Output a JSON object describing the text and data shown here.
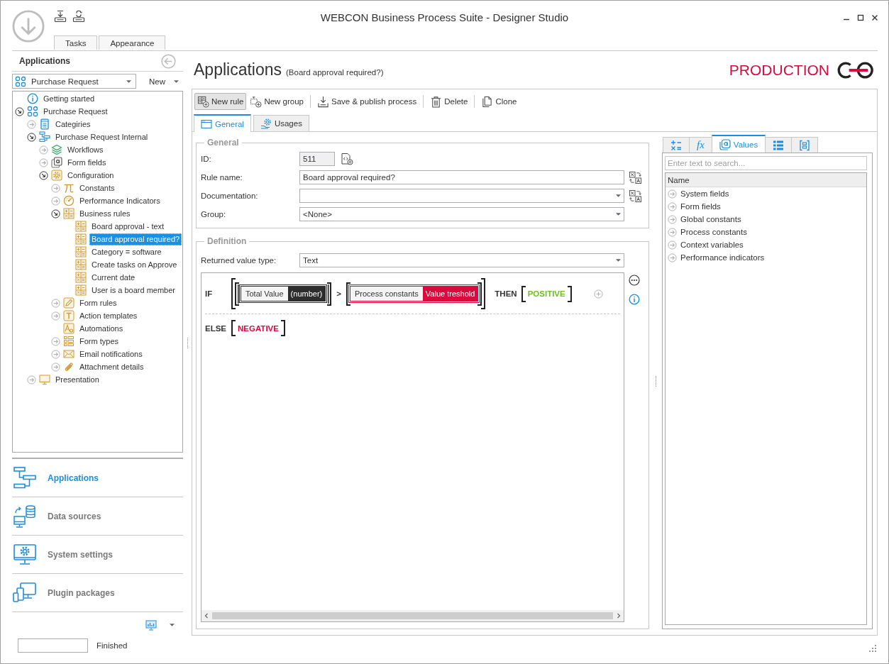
{
  "window": {
    "title": "WEBCON Business Process Suite - Designer Studio"
  },
  "ribbon": {
    "tabs": [
      {
        "label": "Tasks",
        "selected": false
      },
      {
        "label": "Appearance",
        "selected": false
      }
    ]
  },
  "sidebar": {
    "title": "Applications",
    "app_select": {
      "value": "Purchase Request"
    },
    "new_button": {
      "label": "New"
    },
    "tree": [
      {
        "label": "Getting started",
        "kind": "info",
        "selected": false
      },
      {
        "label": "Purchase Request",
        "kind": "app",
        "expanded": true,
        "selected": false,
        "children": [
          {
            "label": "Categiries",
            "kind": "category",
            "expanded": false,
            "selected": false
          },
          {
            "label": "Purchase Request Internal",
            "kind": "process",
            "expanded": true,
            "selected": false,
            "children": [
              {
                "label": "Workflows",
                "kind": "workflow",
                "expanded": false,
                "selected": false
              },
              {
                "label": "Form fields",
                "kind": "formfield",
                "expanded": false,
                "selected": false
              },
              {
                "label": "Configuration",
                "kind": "config",
                "expanded": true,
                "selected": false,
                "children": [
                  {
                    "label": "Constants",
                    "kind": "constant",
                    "expanded": false,
                    "selected": false
                  },
                  {
                    "label": "Performance Indicators",
                    "kind": "kpi",
                    "expanded": false,
                    "selected": false
                  },
                  {
                    "label": "Business rules",
                    "kind": "rule",
                    "expanded": true,
                    "selected": false,
                    "children": [
                      {
                        "label": "Board approval - text",
                        "kind": "rule",
                        "selected": false
                      },
                      {
                        "label": "Board approval required?",
                        "kind": "rule",
                        "selected": true
                      },
                      {
                        "label": "Category = software",
                        "kind": "rule",
                        "selected": false
                      },
                      {
                        "label": "Create tasks on Approve",
                        "kind": "rule",
                        "selected": false
                      },
                      {
                        "label": "Current date",
                        "kind": "rule",
                        "selected": false
                      },
                      {
                        "label": "User is a board member",
                        "kind": "rule",
                        "selected": false
                      }
                    ]
                  },
                  {
                    "label": "Form rules",
                    "kind": "formrule",
                    "expanded": false,
                    "selected": false
                  },
                  {
                    "label": "Action templates",
                    "kind": "template",
                    "expanded": false,
                    "selected": false
                  },
                  {
                    "label": "Automations",
                    "kind": "automation",
                    "selected": false
                  },
                  {
                    "label": "Form types",
                    "kind": "formtype",
                    "expanded": false,
                    "selected": false
                  },
                  {
                    "label": "Email notifications",
                    "kind": "email",
                    "expanded": false,
                    "selected": false
                  },
                  {
                    "label": "Attachment details",
                    "kind": "attachment",
                    "expanded": false,
                    "selected": false
                  }
                ]
              }
            ]
          },
          {
            "label": "Presentation",
            "kind": "presentation",
            "expanded": false,
            "selected": false
          }
        ]
      }
    ],
    "nav": [
      {
        "label": "Applications",
        "kind": "applications",
        "selected": true
      },
      {
        "label": "Data sources",
        "kind": "data-sources",
        "selected": false
      },
      {
        "label": "System settings",
        "kind": "system-settings",
        "selected": false
      },
      {
        "label": "Plugin packages",
        "kind": "plugins",
        "selected": false
      }
    ]
  },
  "status_bar": {
    "text": "Finished"
  },
  "header": {
    "title": "Applications",
    "subtitle": "(Board approval required?)",
    "environment": "PRODUCTION"
  },
  "toolbar": [
    [
      {
        "label": "New rule",
        "kind": "new-rule",
        "pressed": true
      },
      {
        "label": "New group",
        "kind": "new-group",
        "pressed": false
      }
    ],
    [
      {
        "label": "Save & publish process",
        "kind": "save",
        "pressed": false
      }
    ],
    [
      {
        "label": "Delete",
        "kind": "delete",
        "pressed": false
      }
    ],
    [
      {
        "label": "Clone",
        "kind": "clone",
        "pressed": false
      }
    ]
  ],
  "editor_tabs": [
    {
      "label": "General",
      "kind": "general",
      "selected": true
    },
    {
      "label": "Usages",
      "kind": "usages",
      "selected": false
    }
  ],
  "general": {
    "legend": "General",
    "fields": [
      {
        "label": "ID:",
        "kind": "readonly",
        "value": "511",
        "translatable": false
      },
      {
        "label": "Rule name:",
        "kind": "text",
        "value": "Board approval required?",
        "translatable": true
      },
      {
        "label": "Documentation:",
        "kind": "dropdown",
        "translatable": true
      },
      {
        "label": "Group:",
        "kind": "dropdown",
        "value": "<None>",
        "translatable": false
      }
    ]
  },
  "definition": {
    "legend": "Definition",
    "return_type": {
      "label": "Returned value type:",
      "value": "Text"
    },
    "rule": {
      "if_keyword": "IF",
      "condition": {
        "operator": ">",
        "operands": [
          {
            "label": "Total Value",
            "tag": "(number)",
            "color": "#2d2d2d"
          },
          {
            "label": "Process constants",
            "tag": "Value treshold",
            "color": "#dc0a3c"
          }
        ]
      },
      "branches": [
        {
          "keyword": "THEN",
          "value": "POSITIVE",
          "color": "#6cbf1c"
        },
        {
          "keyword": "ELSE",
          "value": "NEGATIVE",
          "color": "#dc0a3c"
        }
      ]
    }
  },
  "values_panel": {
    "tabs": [
      {
        "kind": "operators",
        "selected": false
      },
      {
        "kind": "functions",
        "label": "fx",
        "selected": false
      },
      {
        "kind": "values",
        "label": "Values",
        "selected": true
      },
      {
        "kind": "list",
        "selected": false
      },
      {
        "kind": "bracket",
        "selected": false
      }
    ],
    "search": {
      "placeholder": "Enter text to search..."
    },
    "columns": [
      "Name"
    ],
    "items": [
      {
        "label": "System fields",
        "expanded": false
      },
      {
        "label": "Form fields",
        "expanded": false
      },
      {
        "label": "Global constants",
        "expanded": false
      },
      {
        "label": "Process constants",
        "expanded": false
      },
      {
        "label": "Context variables",
        "expanded": false
      },
      {
        "label": "Performance indicators",
        "expanded": false
      }
    ]
  }
}
